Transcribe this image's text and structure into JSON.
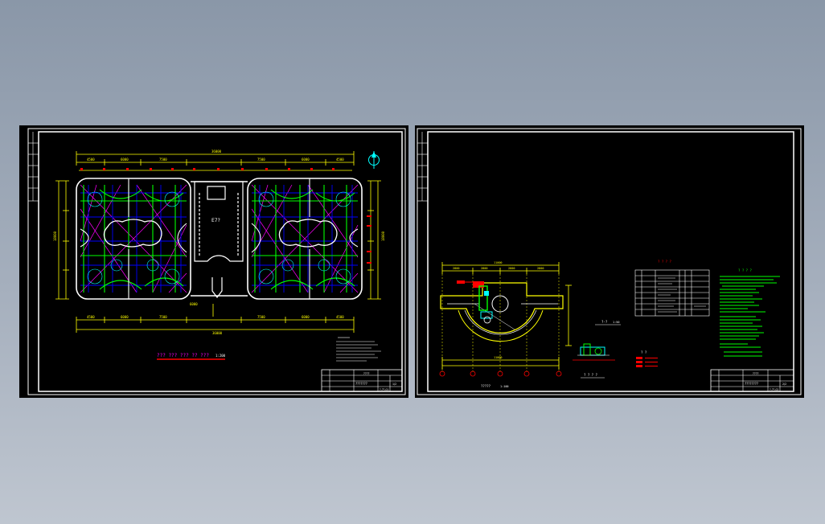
{
  "colors": {
    "background_top": "#8a97a8",
    "background_bottom": "#bfc6d0",
    "sheet": "#000000",
    "frame": "#ffffff",
    "dimension": "#ffff00",
    "wall": "#ffffff",
    "pipe_green": "#00ff00",
    "pipe_magenta": "#ff00ff",
    "pipe_blue": "#0000ff",
    "pipe_cyan": "#00ffff",
    "red": "#ff0000"
  },
  "icons": {
    "north_arrow": "north-arrow-icon",
    "drain_symbol": "drain-symbol-icon"
  },
  "sheet1": {
    "center_label": "E7?",
    "plan_title": "??? ??? ??? ?? ???",
    "plan_scale": "1:200",
    "title_block": {
      "drawing_name": "???????",
      "project": "????",
      "number": "?-??-01",
      "sheet": "1/2"
    }
  },
  "sheet2": {
    "table_title": "? ? ? ?",
    "notes_title": "? ? ? ?",
    "section_label": "?-?",
    "section_scale": "1:50",
    "pump_label": "? ? ? ?",
    "plan_caption": "?????",
    "plan_scale": "1:100",
    "legend_title": "? ?",
    "title_block": {
      "drawing_name": "????????",
      "project": "????",
      "number": "?-??-02",
      "sheet": "2/2"
    }
  }
}
